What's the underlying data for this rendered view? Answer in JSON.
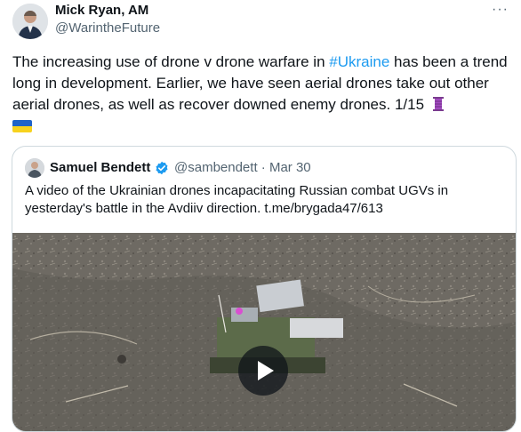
{
  "tweet": {
    "author_name": "Mick Ryan, AM",
    "author_handle": "@WarintheFuture",
    "more_label": "···",
    "text_before_hashtag": "The increasing use of drone v drone warfare in ",
    "hashtag": "#Ukraine",
    "text_after_hashtag": " has been a trend long in development. Earlier, we have seen aerial drones take out other aerial drones, as well as recover downed enemy drones.  1/15",
    "emoji_icons": [
      "thread-icon",
      "ukraine-flag-icon"
    ]
  },
  "quote": {
    "author_name": "Samuel Bendett",
    "verified_icon": "verified-badge-icon",
    "author_handle": "@sambendett",
    "separator": " · ",
    "date": "Mar 30",
    "text": "A video of the Ukrainian drones incapacitating Russian combat UGVs in yesterday's battle in the Avdiiv direction. t.me/brygada47/613",
    "media_icon": "play-icon"
  },
  "colors": {
    "link": "#1d9bf0",
    "muted": "#536471",
    "border": "#cfd9de",
    "verified": "#1d9bf0"
  }
}
